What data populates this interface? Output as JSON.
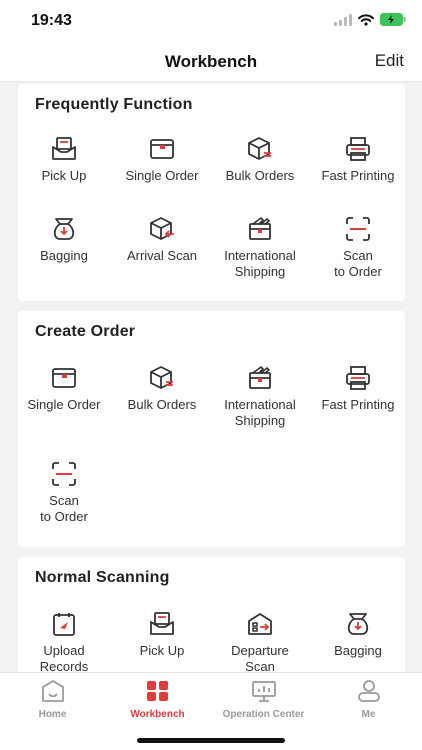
{
  "status": {
    "time": "19:43"
  },
  "header": {
    "title": "Workbench",
    "edit_label": "Edit"
  },
  "colors": {
    "accent": "#e23b3b",
    "icon_stroke": "#333333",
    "background": "#f2f2f4"
  },
  "sections": [
    {
      "title": "Frequently Function",
      "items": [
        {
          "label": "Pick Up",
          "icon": "pickup-icon"
        },
        {
          "label": "Single Order",
          "icon": "single-order-icon"
        },
        {
          "label": "Bulk Orders",
          "icon": "bulk-orders-icon"
        },
        {
          "label": "Fast Printing",
          "icon": "printer-icon"
        },
        {
          "label": "Bagging",
          "icon": "bagging-icon"
        },
        {
          "label": "Arrival Scan",
          "icon": "arrival-scan-icon"
        },
        {
          "label": "International\nShipping",
          "icon": "international-shipping-icon"
        },
        {
          "label": "Scan\nto Order",
          "icon": "scan-icon"
        }
      ]
    },
    {
      "title": "Create Order",
      "items": [
        {
          "label": "Single Order",
          "icon": "single-order-icon"
        },
        {
          "label": "Bulk Orders",
          "icon": "bulk-orders-icon"
        },
        {
          "label": "International\nShipping",
          "icon": "international-shipping-icon"
        },
        {
          "label": "Fast Printing",
          "icon": "printer-icon"
        },
        {
          "label": "Scan\nto Order",
          "icon": "scan-icon"
        }
      ]
    },
    {
      "title": "Normal Scanning",
      "items": [
        {
          "label": "Upload\nRecords",
          "icon": "upload-records-icon"
        },
        {
          "label": "Pick Up",
          "icon": "pickup-icon"
        },
        {
          "label": "Departure\nScan",
          "icon": "departure-scan-icon"
        },
        {
          "label": "Bagging",
          "icon": "bagging-icon"
        }
      ]
    }
  ],
  "tabs": [
    {
      "label": "Home",
      "icon": "home-icon",
      "active": false
    },
    {
      "label": "Workbench",
      "icon": "workbench-icon",
      "active": true
    },
    {
      "label": "Operation Center",
      "icon": "operation-center-icon",
      "active": false
    },
    {
      "label": "Me",
      "icon": "me-icon",
      "active": false
    }
  ]
}
